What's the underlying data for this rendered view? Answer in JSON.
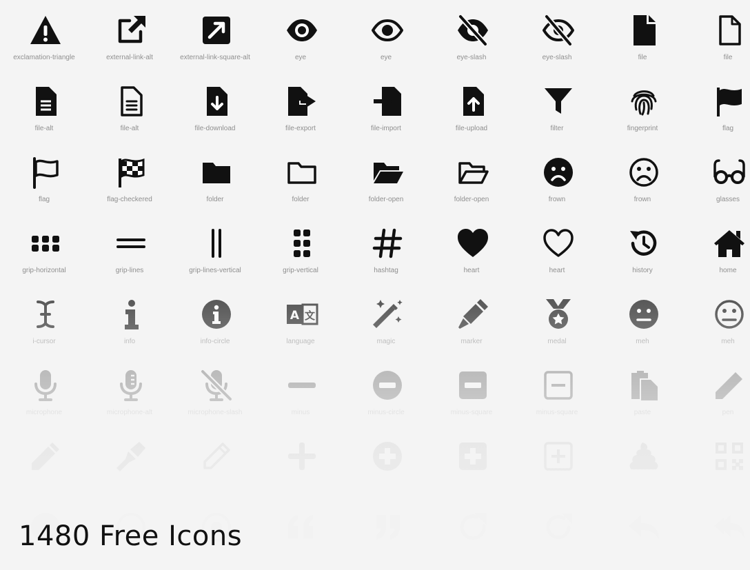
{
  "headline": "1480 Free Icons",
  "icons": [
    {
      "label": "exclamation-triangle",
      "icon": "exclamation-triangle-icon"
    },
    {
      "label": "external-link-alt",
      "icon": "external-link-alt-icon"
    },
    {
      "label": "external-link-square-alt",
      "icon": "external-link-square-alt-icon"
    },
    {
      "label": "eye",
      "icon": "eye-icon"
    },
    {
      "label": "eye",
      "icon": "eye-outline-icon"
    },
    {
      "label": "eye-slash",
      "icon": "eye-slash-icon"
    },
    {
      "label": "eye-slash",
      "icon": "eye-slash-outline-icon"
    },
    {
      "label": "file",
      "icon": "file-icon"
    },
    {
      "label": "file",
      "icon": "file-outline-icon"
    },
    {
      "label": "file-alt",
      "icon": "file-alt-icon"
    },
    {
      "label": "file-alt",
      "icon": "file-alt-outline-icon"
    },
    {
      "label": "file-download",
      "icon": "file-download-icon"
    },
    {
      "label": "file-export",
      "icon": "file-export-icon"
    },
    {
      "label": "file-import",
      "icon": "file-import-icon"
    },
    {
      "label": "file-upload",
      "icon": "file-upload-icon"
    },
    {
      "label": "filter",
      "icon": "filter-icon"
    },
    {
      "label": "fingerprint",
      "icon": "fingerprint-icon"
    },
    {
      "label": "flag",
      "icon": "flag-icon"
    },
    {
      "label": "flag",
      "icon": "flag-outline-icon"
    },
    {
      "label": "flag-checkered",
      "icon": "flag-checkered-icon"
    },
    {
      "label": "folder",
      "icon": "folder-icon"
    },
    {
      "label": "folder",
      "icon": "folder-outline-icon"
    },
    {
      "label": "folder-open",
      "icon": "folder-open-icon"
    },
    {
      "label": "folder-open",
      "icon": "folder-open-outline-icon"
    },
    {
      "label": "frown",
      "icon": "frown-icon"
    },
    {
      "label": "frown",
      "icon": "frown-outline-icon"
    },
    {
      "label": "glasses",
      "icon": "glasses-icon"
    },
    {
      "label": "grip-horizontal",
      "icon": "grip-horizontal-icon"
    },
    {
      "label": "grip-lines",
      "icon": "grip-lines-icon"
    },
    {
      "label": "grip-lines-vertical",
      "icon": "grip-lines-vertical-icon"
    },
    {
      "label": "grip-vertical",
      "icon": "grip-vertical-icon"
    },
    {
      "label": "hashtag",
      "icon": "hashtag-icon"
    },
    {
      "label": "heart",
      "icon": "heart-icon"
    },
    {
      "label": "heart",
      "icon": "heart-outline-icon"
    },
    {
      "label": "history",
      "icon": "history-icon"
    },
    {
      "label": "home",
      "icon": "home-icon"
    },
    {
      "label": "i-cursor",
      "icon": "i-cursor-icon"
    },
    {
      "label": "info",
      "icon": "info-icon"
    },
    {
      "label": "info-circle",
      "icon": "info-circle-icon"
    },
    {
      "label": "language",
      "icon": "language-icon"
    },
    {
      "label": "magic",
      "icon": "magic-icon"
    },
    {
      "label": "marker",
      "icon": "marker-icon"
    },
    {
      "label": "medal",
      "icon": "medal-icon"
    },
    {
      "label": "meh",
      "icon": "meh-icon"
    },
    {
      "label": "meh",
      "icon": "meh-outline-icon"
    },
    {
      "label": "microphone",
      "icon": "microphone-icon"
    },
    {
      "label": "microphone-alt",
      "icon": "microphone-alt-icon"
    },
    {
      "label": "microphone-slash",
      "icon": "microphone-slash-icon"
    },
    {
      "label": "minus",
      "icon": "minus-icon"
    },
    {
      "label": "minus-circle",
      "icon": "minus-circle-icon"
    },
    {
      "label": "minus-square",
      "icon": "minus-square-icon"
    },
    {
      "label": "minus-square",
      "icon": "minus-square-outline-icon"
    },
    {
      "label": "paste",
      "icon": "paste-icon"
    },
    {
      "label": "pen",
      "icon": "pen-icon"
    },
    {
      "label": "",
      "icon": "pencil-alt-icon"
    },
    {
      "label": "",
      "icon": "pen-fancy-icon"
    },
    {
      "label": "",
      "icon": "pencil-outline-icon"
    },
    {
      "label": "",
      "icon": "plus-icon"
    },
    {
      "label": "",
      "icon": "plus-circle-icon"
    },
    {
      "label": "",
      "icon": "plus-square-icon"
    },
    {
      "label": "",
      "icon": "plus-square-outline-icon"
    },
    {
      "label": "",
      "icon": "poo-icon"
    },
    {
      "label": "",
      "icon": "qrcode-icon"
    },
    {
      "label": "",
      "icon": "question-circle-icon"
    },
    {
      "label": "",
      "icon": "question-circle-outline-icon"
    },
    {
      "label": "",
      "icon": "question-circle-alt-icon"
    },
    {
      "label": "",
      "icon": "quote-left-icon"
    },
    {
      "label": "",
      "icon": "quote-right-icon"
    },
    {
      "label": "",
      "icon": "redo-icon"
    },
    {
      "label": "",
      "icon": "redo-alt-icon"
    },
    {
      "label": "",
      "icon": "reply-icon"
    },
    {
      "label": "",
      "icon": "reply-all-icon"
    }
  ]
}
